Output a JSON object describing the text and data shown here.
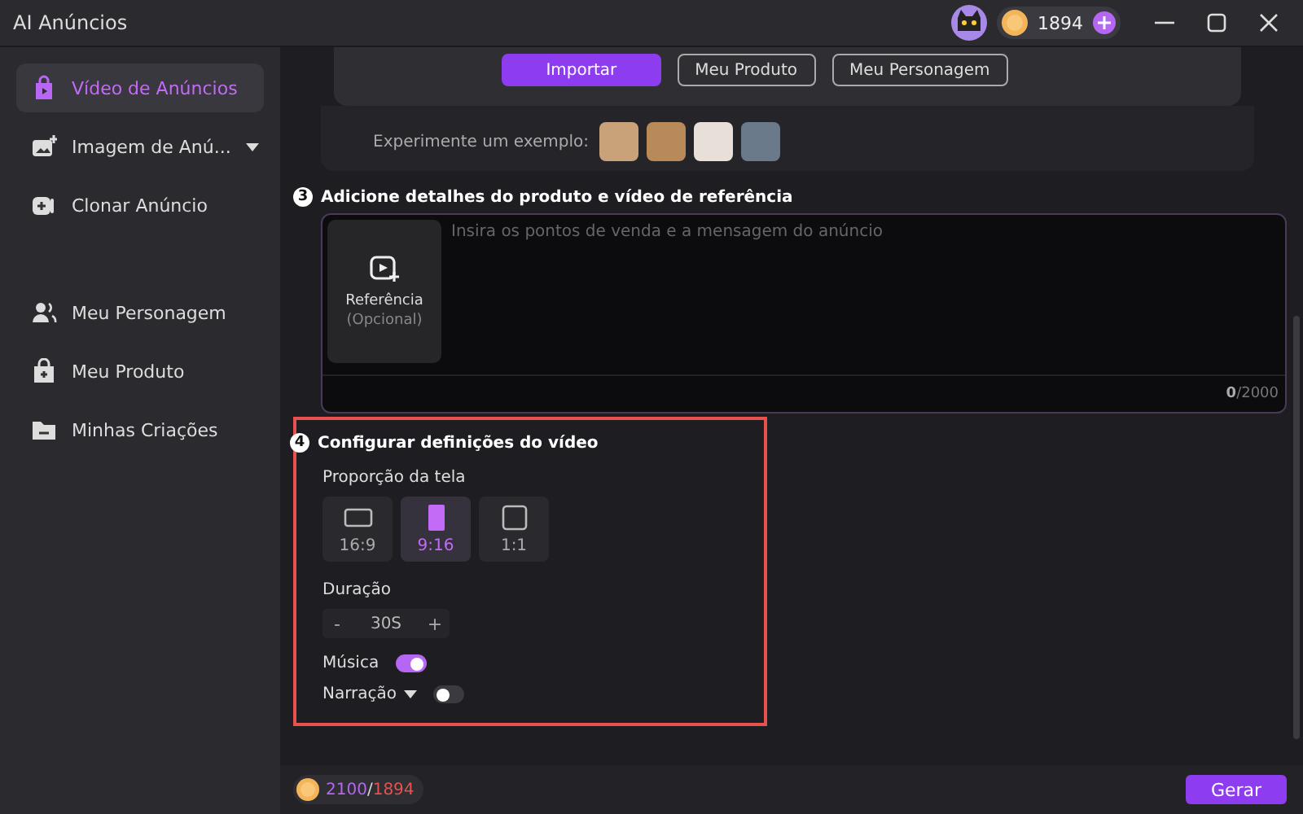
{
  "window": {
    "title": "AI Anúncios",
    "credits": "1894"
  },
  "sidebar": {
    "items": [
      {
        "label": "Vídeo de Anúncios",
        "selected": true,
        "dropdown": false
      },
      {
        "label": "Imagem de Anú...",
        "selected": false,
        "dropdown": true
      },
      {
        "label": "Clonar Anúncio",
        "selected": false,
        "dropdown": false
      },
      {
        "label": "Meu Personagem",
        "selected": false,
        "dropdown": false
      },
      {
        "label": "Meu Produto",
        "selected": false,
        "dropdown": false
      },
      {
        "label": "Minhas Criações",
        "selected": false,
        "dropdown": false
      }
    ]
  },
  "upload": {
    "buttons": [
      {
        "label": "Importar",
        "primary": true
      },
      {
        "label": "Meu Produto",
        "primary": false
      },
      {
        "label": "Meu Personagem",
        "primary": false
      }
    ],
    "examples_label": "Experimente um exemplo:"
  },
  "details": {
    "number": "3",
    "title": "Adicione detalhes do produto e vídeo de referência",
    "reference": {
      "label": "Referência",
      "hint": "(Opcional)"
    },
    "placeholder": "Insira os pontos de venda e a mensagem do anúncio",
    "count": "0",
    "max": "/2000"
  },
  "settings": {
    "number": "4",
    "title": "Configurar definições do vídeo",
    "highlighted": true,
    "ratio_label": "Proporção da tela",
    "ratios": [
      {
        "label": "16:9",
        "selected": false
      },
      {
        "label": "9:16",
        "selected": true
      },
      {
        "label": "1:1",
        "selected": false
      }
    ],
    "duration_label": "Duração",
    "duration": {
      "minus": "-",
      "value": "30S",
      "plus": "+"
    },
    "toggles": [
      {
        "label": "Música",
        "on": true,
        "dropdown": false
      },
      {
        "label": "Narração",
        "on": false,
        "dropdown": true
      }
    ]
  },
  "footer": {
    "needed": "2100",
    "separator": "/",
    "available": "1894",
    "button": "Gerar"
  }
}
